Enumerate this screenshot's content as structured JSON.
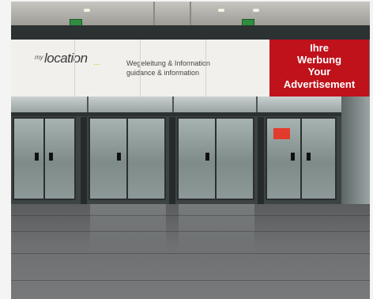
{
  "scene": {
    "description_type": "photo",
    "sign": {
      "logo_prefix": "my",
      "logo_main": "location",
      "logo_suffix": "...",
      "info_line_1": "Wegeleitung & Information",
      "info_line_2": "guidance & information"
    },
    "advertisement": {
      "line1": "Ihre",
      "line2": "Werbung",
      "line3": "Your",
      "line4": "Advertisement",
      "color": "#c0121b"
    }
  }
}
